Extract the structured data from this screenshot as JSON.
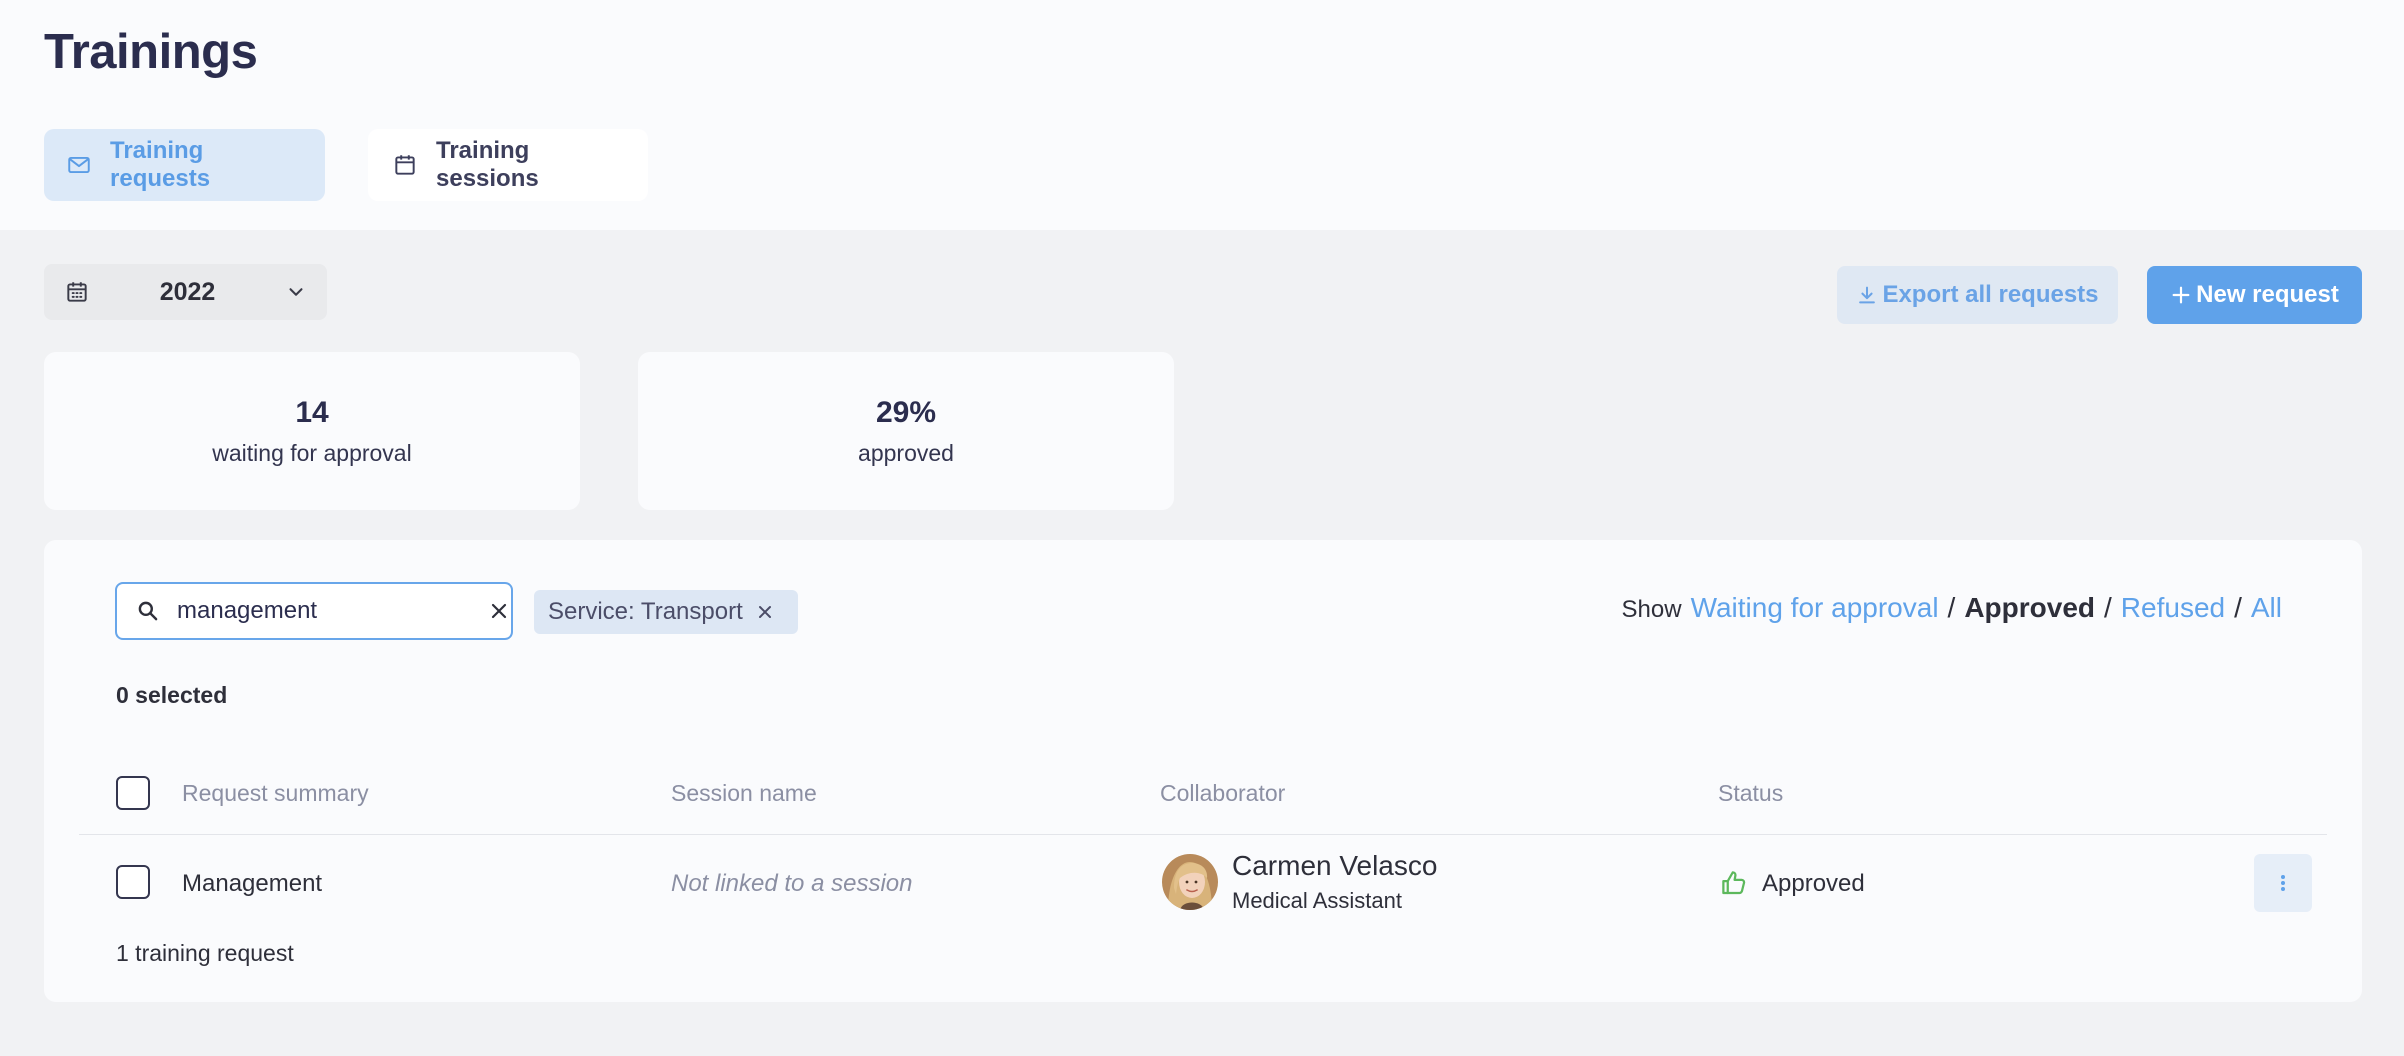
{
  "page": {
    "title": "Trainings"
  },
  "tabs": [
    {
      "label": "Training requests",
      "icon": "mail-icon",
      "active": true
    },
    {
      "label": "Training sessions",
      "icon": "calendar-icon",
      "active": false
    }
  ],
  "year_select": {
    "value": "2022"
  },
  "actions": {
    "export_label": "Export all requests",
    "new_label": "New request"
  },
  "stats": [
    {
      "value": "14",
      "label": "waiting for approval"
    },
    {
      "value": "29%",
      "label": "approved"
    }
  ],
  "search": {
    "value": "management"
  },
  "filter_chip": {
    "label": "Service: Transport"
  },
  "show_filter": {
    "label": "Show",
    "options": [
      "Waiting for approval",
      "Approved",
      "Refused",
      "All"
    ],
    "active": "Approved"
  },
  "selection": {
    "count_text": "0 selected"
  },
  "table": {
    "columns": [
      "Request summary",
      "Session name",
      "Collaborator",
      "Status"
    ],
    "rows": [
      {
        "summary": "Management",
        "session": "Not linked to a session",
        "collaborator_name": "Carmen Velasco",
        "collaborator_role": "Medical Assistant",
        "status": "Approved"
      }
    ],
    "total_text": "1 training request"
  },
  "colors": {
    "accent": "#5fa2ea",
    "approved_green": "#5cb85c",
    "text_dark": "#2b2d4e",
    "muted": "#8b8fa3"
  }
}
